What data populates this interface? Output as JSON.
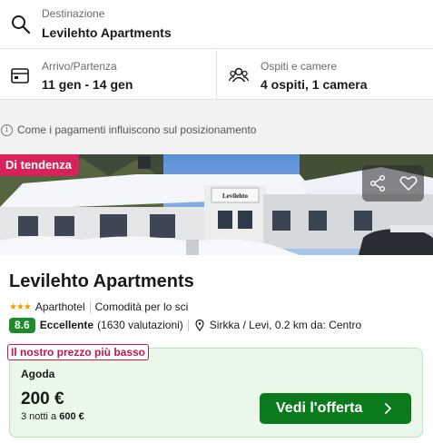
{
  "search": {
    "destination_label": "Destinazione",
    "destination_value": "Levilehto Apartments",
    "dates_label": "Arrivo/Partenza",
    "dates_value": "11 gen - 14 gen",
    "guests_label": "Ospiti e camere",
    "guests_value": "4 ospiti, 1 camera"
  },
  "info": {
    "icon": "info-icon",
    "text": "Come i pagamenti influiscono sul posizionamento"
  },
  "hotel": {
    "trend_badge": "Di tendenza",
    "name": "Levilehto Apartments",
    "stars": 3,
    "type": "Aparthotel",
    "feature": "Comodità per lo sci",
    "score": "8.6",
    "score_word": "Eccellente",
    "reviews": "(1630 valutazioni)",
    "location": "Sirkka / Levi, 0.2 km da: Centro",
    "photo_sign": "Levilehto apartments"
  },
  "offer": {
    "best_price_badge": "Il nostro prezzo più basso",
    "provider": "Agoda",
    "price": "200 €",
    "nights_prefix": "3 notti a",
    "nights_total": "600 €",
    "cta_label": "Vedi l'offerta"
  },
  "colors": {
    "trend_badge": "#d6235a",
    "score_bg": "#1d8a2b",
    "cta_bg": "#0b7a1c",
    "offer_bg": "#eaf8ea",
    "best_badge": "#c2184b",
    "stars": "#e5a100"
  }
}
